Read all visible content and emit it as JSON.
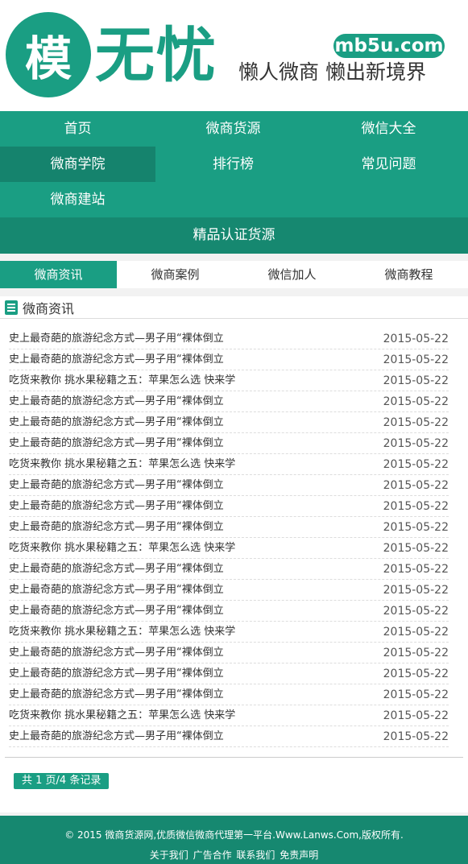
{
  "header": {
    "logo_char": "模",
    "logo_text": "无忧",
    "domain": "mb5u.com",
    "slogan": "懒人微商  懒出新境界"
  },
  "nav": {
    "row1": [
      "首页",
      "微商货源",
      "微信大全"
    ],
    "row2": [
      "微商学院",
      "排行榜",
      "常见问题"
    ],
    "row3": [
      "微商建站"
    ],
    "bottom": "精品认证货源"
  },
  "tabs": [
    "微商资讯",
    "微商案例",
    "微信加人",
    "微商教程"
  ],
  "panel": {
    "title": "微商资讯",
    "items": [
      {
        "title": "史上最奇葩的旅游纪念方式—男子用“裸体倒立",
        "date": "2015-05-22"
      },
      {
        "title": "史上最奇葩的旅游纪念方式—男子用“裸体倒立",
        "date": "2015-05-22"
      },
      {
        "title": "吃货来教你 挑水果秘籍之五：苹果怎么选 快来学",
        "date": "2015-05-22"
      },
      {
        "title": "史上最奇葩的旅游纪念方式—男子用“裸体倒立",
        "date": "2015-05-22"
      },
      {
        "title": "史上最奇葩的旅游纪念方式—男子用“裸体倒立",
        "date": "2015-05-22"
      },
      {
        "title": "史上最奇葩的旅游纪念方式—男子用“裸体倒立",
        "date": "2015-05-22"
      },
      {
        "title": "吃货来教你 挑水果秘籍之五：苹果怎么选 快来学",
        "date": "2015-05-22"
      },
      {
        "title": "史上最奇葩的旅游纪念方式—男子用“裸体倒立",
        "date": "2015-05-22"
      },
      {
        "title": "史上最奇葩的旅游纪念方式—男子用“裸体倒立",
        "date": "2015-05-22"
      },
      {
        "title": "史上最奇葩的旅游纪念方式—男子用“裸体倒立",
        "date": "2015-05-22"
      },
      {
        "title": "吃货来教你 挑水果秘籍之五：苹果怎么选 快来学",
        "date": "2015-05-22"
      },
      {
        "title": "史上最奇葩的旅游纪念方式—男子用“裸体倒立",
        "date": "2015-05-22"
      },
      {
        "title": "史上最奇葩的旅游纪念方式—男子用“裸体倒立",
        "date": "2015-05-22"
      },
      {
        "title": "史上最奇葩的旅游纪念方式—男子用“裸体倒立",
        "date": "2015-05-22"
      },
      {
        "title": "吃货来教你 挑水果秘籍之五：苹果怎么选 快来学",
        "date": "2015-05-22"
      },
      {
        "title": "史上最奇葩的旅游纪念方式—男子用“裸体倒立",
        "date": "2015-05-22"
      },
      {
        "title": "史上最奇葩的旅游纪念方式—男子用“裸体倒立",
        "date": "2015-05-22"
      },
      {
        "title": "史上最奇葩的旅游纪念方式—男子用“裸体倒立",
        "date": "2015-05-22"
      },
      {
        "title": "吃货来教你 挑水果秘籍之五：苹果怎么选 快来学",
        "date": "2015-05-22"
      },
      {
        "title": "史上最奇葩的旅游纪念方式—男子用“裸体倒立",
        "date": "2015-05-22"
      }
    ],
    "pager": "共 1 页/4 条记录"
  },
  "footer": {
    "copyright": "© 2015 微商货源网,优质微信微商代理第一平台.Www.Lanws.Com,版权所有.",
    "links": [
      "关于我们",
      "广告合作",
      "联系我们",
      "免责声明"
    ]
  },
  "colors": {
    "brand": "#1a9e83",
    "brand_dark": "#168870"
  }
}
